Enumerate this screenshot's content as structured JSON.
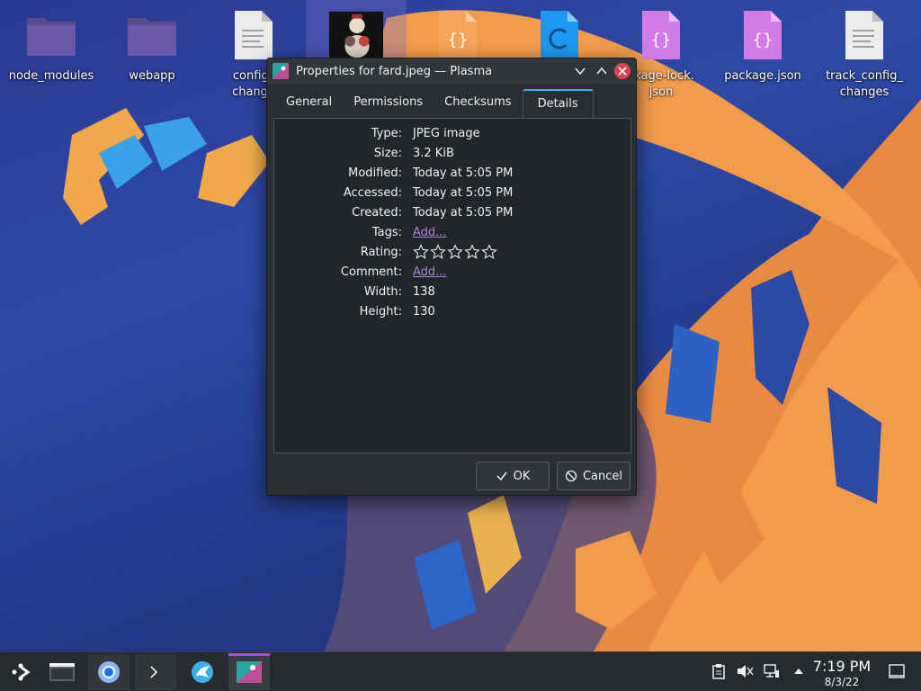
{
  "desktop": {
    "icons": [
      {
        "label": "node_modules",
        "type": "folder"
      },
      {
        "label": "webapp",
        "type": "folder"
      },
      {
        "label": "config_\nchange",
        "type": "text"
      },
      {
        "label": "",
        "type": "image"
      },
      {
        "label": "",
        "type": "json"
      },
      {
        "label": "",
        "type": "css"
      },
      {
        "label": "ckage-lock.\njson",
        "type": "json"
      },
      {
        "label": "package.json",
        "type": "json"
      },
      {
        "label": "track_config_\nchanges",
        "type": "text"
      }
    ]
  },
  "dialog": {
    "title": "Properties for fard.jpeg — Plasma",
    "tabs": [
      "General",
      "Permissions",
      "Checksums",
      "Details"
    ],
    "active_tab": "Details",
    "fields": {
      "type": {
        "label": "Type:",
        "value": "JPEG image"
      },
      "size": {
        "label": "Size:",
        "value": "3.2 KiB"
      },
      "modified": {
        "label": "Modified:",
        "value": "Today at 5:05 PM"
      },
      "accessed": {
        "label": "Accessed:",
        "value": "Today at 5:05 PM"
      },
      "created": {
        "label": "Created:",
        "value": "Today at 5:05 PM"
      },
      "tags": {
        "label": "Tags:",
        "value": "Add..."
      },
      "rating": {
        "label": "Rating:",
        "value": 0,
        "max": 5
      },
      "comment": {
        "label": "Comment:",
        "value": "Add..."
      },
      "width": {
        "label": "Width:",
        "value": "138"
      },
      "height": {
        "label": "Height:",
        "value": "130"
      }
    },
    "buttons": {
      "ok": "OK",
      "cancel": "Cancel"
    }
  },
  "taskbar": {
    "tasks": [
      "application-launcher-icon",
      "file-manager-icon",
      "chromium-icon",
      "terminal-icon",
      "discover-icon",
      "properties-app-icon"
    ],
    "active_task": "properties-app-icon",
    "clock": {
      "time": "7:19 PM",
      "date": "8/3/22"
    }
  },
  "colors": {
    "accent": "#3daee9",
    "link": "#a584de",
    "close": "#da4453",
    "taskbar_active": "#9b59d0"
  }
}
